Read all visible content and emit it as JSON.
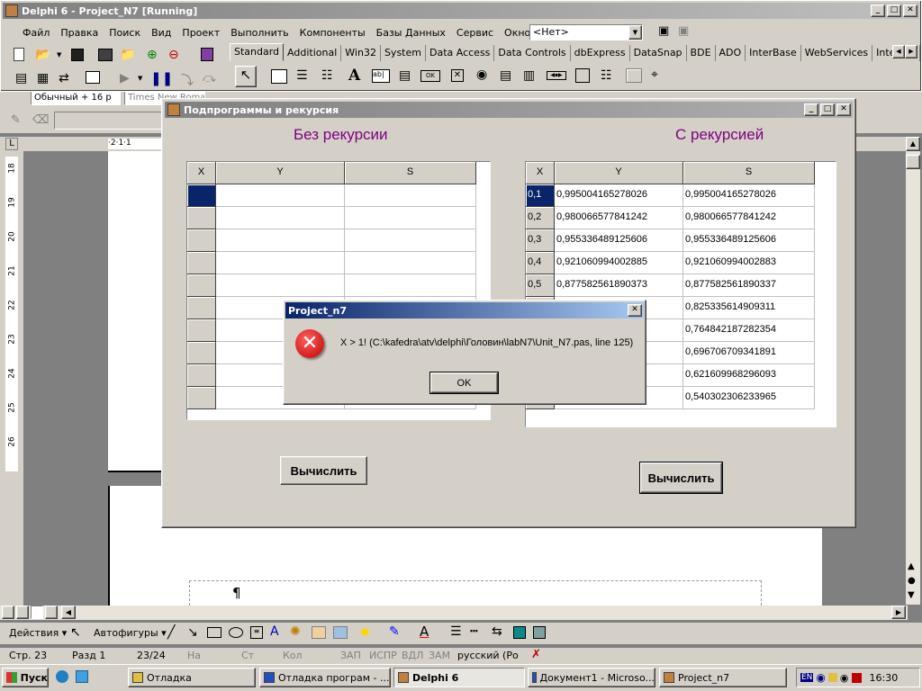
{
  "ide": {
    "title": "Delphi 6 - Project_N7 [Running]",
    "menu": [
      "Файл",
      "Правка",
      "Поиск",
      "Вид",
      "Проект",
      "Выполнить",
      "Компоненты",
      "Базы Данных",
      "Сервис",
      "Окно",
      "Помощь"
    ],
    "combo_value": "<Нет>",
    "palette_tabs": [
      "Standard",
      "Additional",
      "Win32",
      "System",
      "Data Access",
      "Data Controls",
      "dbExpress",
      "DataSnap",
      "BDE",
      "ADO",
      "InterBase",
      "WebServices",
      "Internet"
    ]
  },
  "word": {
    "style_value": "Обычный + 16 р",
    "font_value": "Times New Roman",
    "ruler_top": "·2·1·1",
    "ruler_left": [
      "18",
      "19",
      "20",
      "21",
      "22",
      "23",
      "24",
      "25",
      "26"
    ],
    "para_mark": "¶",
    "draw_toolbar": {
      "actions": "Действия ▾",
      "autoshapes": "Автофигуры ▾"
    },
    "status": {
      "page": "Стр. 23",
      "section": "Разд 1",
      "pages": "23/24",
      "at": "На",
      "line": "Ст",
      "col": "Кол",
      "rec": "ЗАП",
      "trk": "ИСПР",
      "ext": "ВДЛ",
      "ovr": "ЗАМ",
      "lang": "русский (Ро"
    }
  },
  "form": {
    "title": "Подпрограммы и рекурсия",
    "left_heading": "Без рекурсии",
    "right_heading": "С рекурсией",
    "grid_headers": [
      "X",
      "Y",
      "S"
    ],
    "left_rows": 10,
    "right_rows": [
      [
        "0,1",
        "0,995004165278026",
        "0,995004165278026"
      ],
      [
        "0,2",
        "0,980066577841242",
        "0,980066577841242"
      ],
      [
        "0,3",
        "0,955336489125606",
        "0,955336489125606"
      ],
      [
        "0,4",
        "0,921060994002885",
        "0,921060994002883"
      ],
      [
        "0,5",
        "0,877582561890373",
        "0,877582561890337"
      ],
      [
        "",
        "3",
        "0,825335614909311"
      ],
      [
        "",
        "3",
        "0,764842187282354"
      ],
      [
        "",
        "",
        "0,696706709341891"
      ],
      [
        "",
        "5",
        "0,621609968296093"
      ],
      [
        "",
        "",
        "0,540302306233965"
      ]
    ],
    "calc_button_left": "Вычислить",
    "calc_button_right": "Вычислить"
  },
  "dialog": {
    "title": "Project_n7",
    "message": "X > 1! (C:\\kafedra\\atv\\delphi\\Головин\\labN7\\Unit_N7.pas, line 125)",
    "ok": "OK"
  },
  "taskbar": {
    "start": "Пуск",
    "tasks": [
      "Отладка",
      "Отладка програм - ...",
      "Delphi 6",
      "Документ1 - Microso...",
      "Project_n7"
    ],
    "lang": "EN",
    "clock": "16:30"
  },
  "colors": {
    "titlebar_active": "#0a246a",
    "titlebar_inactive": "#808080",
    "heading": "#800080",
    "selected": "#0a246a",
    "error": "#d81e1e"
  }
}
